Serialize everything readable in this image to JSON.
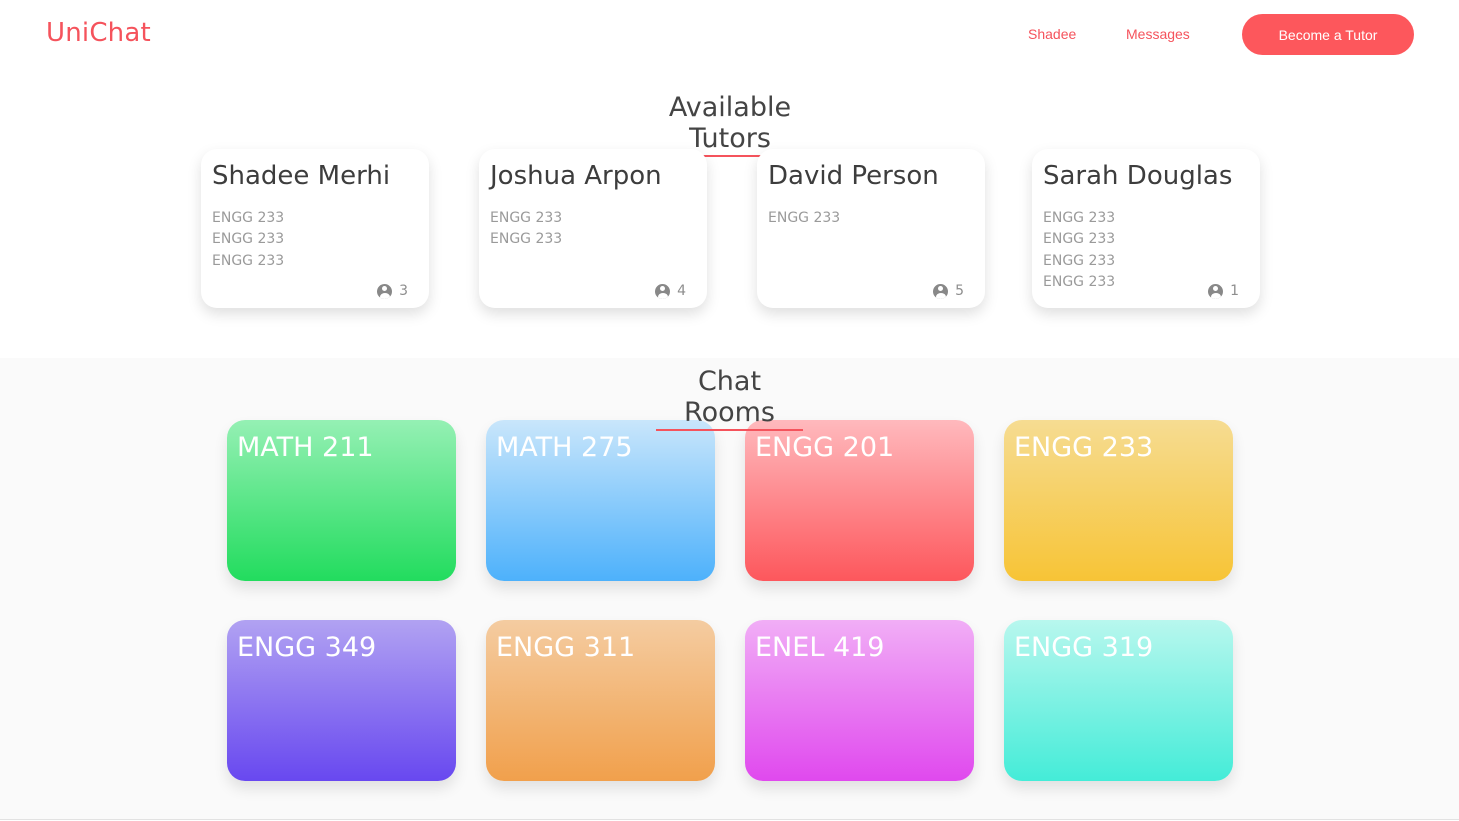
{
  "header": {
    "logo": "UniChat",
    "user_link": "Shadee",
    "messages_link": "Messages",
    "tutor_button": "Become a Tutor"
  },
  "tutors_section": {
    "title": "Available Tutors",
    "tutors": [
      {
        "name": "Shadee Merhi",
        "courses": [
          "ENGG 233",
          "ENGG 233",
          "ENGG 233"
        ],
        "count": "3"
      },
      {
        "name": "Joshua Arpon",
        "courses": [
          "ENGG 233",
          "ENGG 233"
        ],
        "count": "4"
      },
      {
        "name": "David Person",
        "courses": [
          "ENGG 233"
        ],
        "count": "5"
      },
      {
        "name": "Sarah Douglas",
        "courses": [
          "ENGG 233",
          "ENGG 233",
          "ENGG 233",
          "ENGG 233"
        ],
        "count": "1"
      }
    ]
  },
  "rooms_section": {
    "title": "Chat Rooms",
    "rooms": [
      {
        "label": "MATH 211",
        "color_top": "#95f0b4",
        "color_bottom": "#22dc5e"
      },
      {
        "label": "MATH 275",
        "color_top": "#c9e6fb",
        "color_bottom": "#4db1fb"
      },
      {
        "label": "ENGG 201",
        "color_top": "#ffb9bd",
        "color_bottom": "#fd575c"
      },
      {
        "label": "ENGG 233",
        "color_top": "#f6dc92",
        "color_bottom": "#f7c436"
      },
      {
        "label": "ENGG 349",
        "color_top": "#b1a2f2",
        "color_bottom": "#6848f0"
      },
      {
        "label": "ENGG 311",
        "color_top": "#f4cca1",
        "color_bottom": "#f1a04c"
      },
      {
        "label": "ENEL 419",
        "color_top": "#f1aef6",
        "color_bottom": "#e049ee"
      },
      {
        "label": "ENGG 319",
        "color_top": "#b8f7ee",
        "color_bottom": "#44ecd8"
      }
    ]
  },
  "colors": {
    "accent": "#f5535c",
    "button": "#fd575c"
  },
  "icons": {
    "count_icon": "user-circle-icon"
  }
}
